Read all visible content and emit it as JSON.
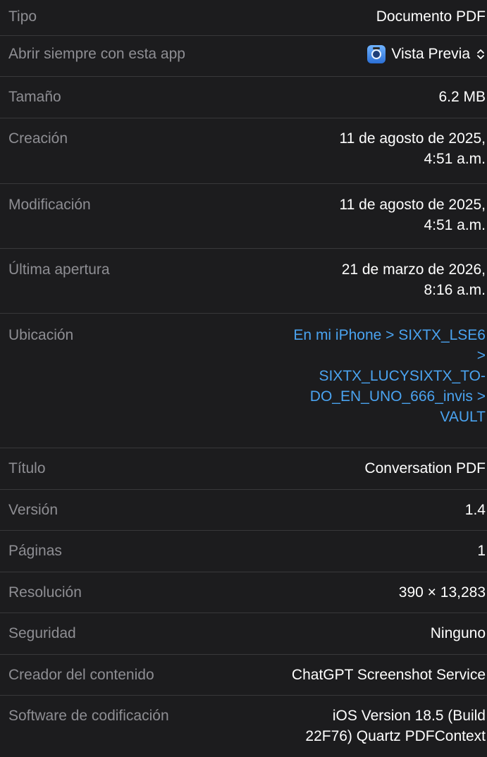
{
  "rows": {
    "tipo": {
      "label": "Tipo",
      "value": "Documento PDF"
    },
    "abrir": {
      "label": "Abrir siempre con esta app",
      "value": "Vista Previa",
      "icon": "preview-app-icon"
    },
    "tamano": {
      "label": "Tamaño",
      "value": "6.2 MB"
    },
    "creacion": {
      "label": "Creación",
      "value_line1": "11 de agosto de 2025,",
      "value_line2": "4:51 a.m."
    },
    "modificacion": {
      "label": "Modificación",
      "value_line1": "11 de agosto de 2025,",
      "value_line2": "4:51 a.m."
    },
    "ultima": {
      "label": "Última apertura",
      "value_line1": "21 de marzo de 2026,",
      "value_line2": "8:16 a.m."
    },
    "ubicacion": {
      "label": "Ubicación",
      "lines": [
        "En mi iPhone > SIXTX_LSE6",
        ">",
        "SIXTX_LUCYSIXTX_TO-",
        "DO_EN_UNO_666_invis >",
        "VAULT"
      ],
      "color": "#4aa3f0"
    },
    "titulo": {
      "label": "Título",
      "value": "Conversation PDF"
    },
    "version": {
      "label": "Versión",
      "value": "1.4"
    },
    "paginas": {
      "label": "Páginas",
      "value": "1"
    },
    "resolucion": {
      "label": "Resolución",
      "value": "390 × 13,283"
    },
    "seguridad": {
      "label": "Seguridad",
      "value": "Ninguno"
    },
    "creador": {
      "label": "Creador del contenido",
      "value": "ChatGPT Screenshot Service"
    },
    "software": {
      "label": "Software de codificación",
      "value_line1": "iOS Version 18.5 (Build",
      "value_line2": "22F76) Quartz PDFContext"
    }
  },
  "colors": {
    "background": "#1c1c1e",
    "label": "#8e8e93",
    "value": "#ffffff",
    "link": "#4aa3f0",
    "separator": "#38383a"
  }
}
